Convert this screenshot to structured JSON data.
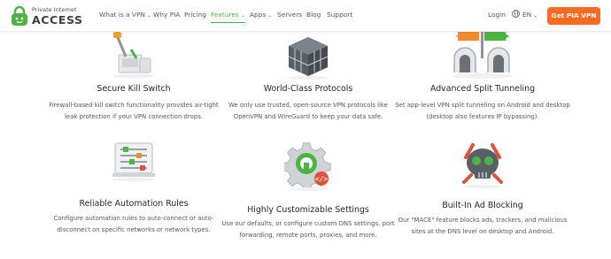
{
  "header": {
    "logo_small": "Private Internet",
    "logo_big": "ACCESS",
    "nav": [
      {
        "label": "What is a VPN",
        "dropdown": true,
        "active": false
      },
      {
        "label": "Why PIA",
        "dropdown": false,
        "active": false
      },
      {
        "label": "Pricing",
        "dropdown": false,
        "active": false
      },
      {
        "label": "Features",
        "dropdown": true,
        "active": true
      },
      {
        "label": "Apps",
        "dropdown": true,
        "active": false
      },
      {
        "label": "Servers",
        "dropdown": false,
        "active": false
      },
      {
        "label": "Blog",
        "dropdown": false,
        "active": false
      },
      {
        "label": "Support",
        "dropdown": false,
        "active": false
      }
    ],
    "login": "Login",
    "language": "EN",
    "cta": "Get PIA VPN"
  },
  "features": [
    {
      "title": "Secure Kill Switch",
      "icon": "kill-switch-lever-icon",
      "desc": "Firewall-based kill switch functionality provides air-tight leak protection if your VPN connection drops."
    },
    {
      "title": "World-Class Protocols",
      "icon": "protocol-cube-icon",
      "desc": "We only use trusted, open-source VPN protocols like OpenVPN and WireGuard to keep your data safe."
    },
    {
      "title": "Advanced Split Tunneling",
      "icon": "split-tunnel-icon",
      "desc": "Set app-level VPN split tunneling on Android and desktop (desktop also features IP bypassing)."
    },
    {
      "title": "Reliable Automation Rules",
      "icon": "automation-sliders-icon",
      "desc": "Configure automation rules to auto-connect or auto-disconnect on specific networks or network types."
    },
    {
      "title": "Highly Customizable Settings",
      "icon": "settings-gear-lock-icon",
      "desc": "Use our defaults, or configure custom DNS settings, port forwarding, remote ports, proxies, and more."
    },
    {
      "title": "Built-In Ad Blocking",
      "icon": "ad-blocker-skull-icon",
      "desc": "Our \"MACE\" feature blocks ads, trackers, and malicious sites at the DNS level on desktop and Android."
    }
  ],
  "colors": {
    "brand_green": "#4bb543",
    "cta_orange": "#fd6a21",
    "title_text": "#24272e",
    "body_text": "#525866"
  }
}
